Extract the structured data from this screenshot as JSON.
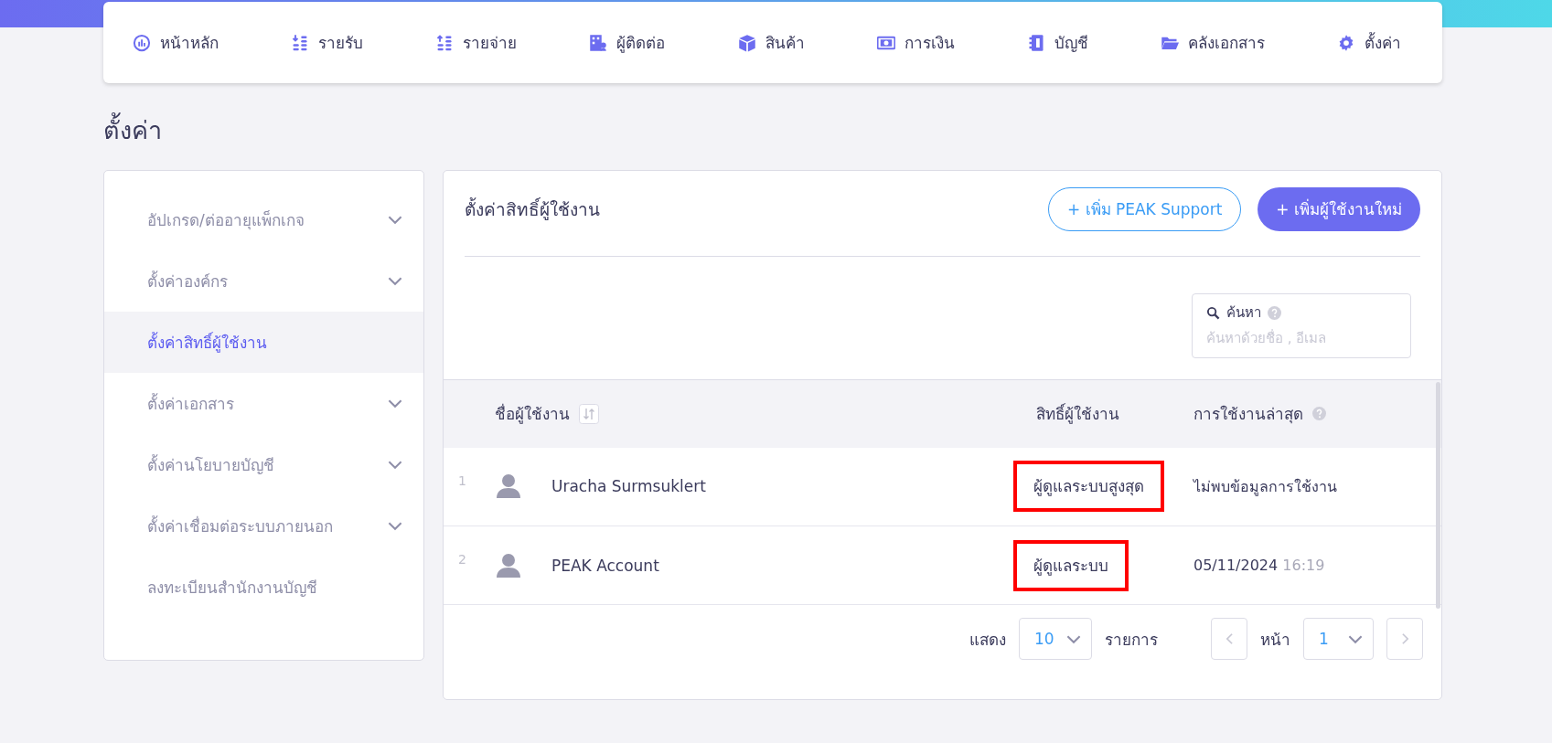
{
  "nav": [
    {
      "label": "หน้าหลัก"
    },
    {
      "label": "รายรับ"
    },
    {
      "label": "รายจ่าย"
    },
    {
      "label": "ผู้ติดต่อ"
    },
    {
      "label": "สินค้า"
    },
    {
      "label": "การเงิน"
    },
    {
      "label": "บัญชี"
    },
    {
      "label": "คลังเอกสาร"
    },
    {
      "label": "ตั้งค่า"
    }
  ],
  "page_title": "ตั้งค่า",
  "sidebar": {
    "items": [
      {
        "label": "อัปเกรด/ต่ออายุแพ็กเกจ",
        "selected": false,
        "expandable": true
      },
      {
        "label": "ตั้งค่าองค์กร",
        "selected": false,
        "expandable": true
      },
      {
        "label": "ตั้งค่าสิทธิ์ผู้ใช้งาน",
        "selected": true,
        "expandable": false
      },
      {
        "label": "ตั้งค่าเอกสาร",
        "selected": false,
        "expandable": true
      },
      {
        "label": "ตั้งค่านโยบายบัญชี",
        "selected": false,
        "expandable": true
      },
      {
        "label": "ตั้งค่าเชื่อมต่อระบบภายนอก",
        "selected": false,
        "expandable": true
      },
      {
        "label": "ลงทะเบียนสำนักงานบัญชี",
        "selected": false,
        "expandable": false
      }
    ]
  },
  "panel": {
    "title": "ตั้งค่าสิทธิ์ผู้ใช้งาน",
    "buttons": [
      {
        "label": "+ เพิ่ม PEAK Support",
        "kind": "outline"
      },
      {
        "label": "+ เพิ่มผู้ใช้งานใหม่",
        "kind": "primary"
      }
    ],
    "search": {
      "label": "ค้นหา",
      "placeholder": "ค้นหาด้วยชื่อ , อีเมล"
    }
  },
  "table": {
    "columns": [
      "ชื่อผู้ใช้งาน",
      "สิทธิ์ผู้ใช้งาน",
      "การใช้งานล่าสุด"
    ],
    "rows": [
      {
        "number": "1",
        "name": "Uracha Surmsuklert",
        "role": "ผู้ดูแลระบบสูงสุด",
        "highlighted": true,
        "last_used": "ไม่พบข้อมูลการใช้งาน"
      },
      {
        "number": "2",
        "name": "PEAK Account",
        "role": "ผู้ดูแลระบบ",
        "highlighted": true,
        "last_used": "05/11/2024",
        "last_used_time": "16:19"
      }
    ]
  },
  "pagination": {
    "show_label": "แสดง",
    "page_size": "10",
    "items_label": "รายการ",
    "page_label": "หน้า",
    "page": "1"
  }
}
